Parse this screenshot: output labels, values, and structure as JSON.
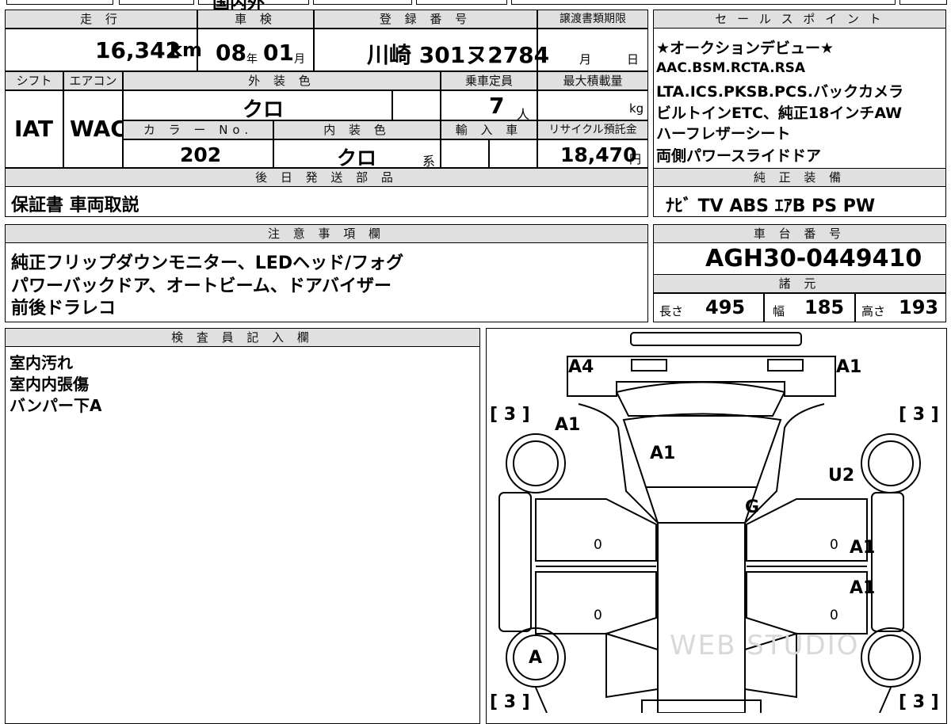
{
  "top_cutoff": "国内外",
  "header_labels": {
    "mileage": "走 行",
    "inspection": "車 検",
    "registration": "登 録 番 号",
    "transfer_deadline": "譲渡書類期限",
    "shift": "シフト",
    "aircon": "エアコン",
    "exterior_color": "外 装 色",
    "capacity": "乗車定員",
    "max_load": "最大積載量",
    "color_no": "カ ラ ー No.",
    "interior_color": "内 装 色",
    "import": "輸 入 車",
    "recycle_fee": "リサイクル預託金",
    "later_parts": "後 日 発 送 部 品",
    "sales_points": "セ ー ル ス ポ イ ン ト",
    "standard_equipment": "純 正 装 備",
    "notes": "注 意 事 項 欄",
    "chassis_no": "車 台 番 号",
    "specs": "諸 元",
    "inspector": "検 査 員 記 入 欄"
  },
  "vehicle": {
    "mileage_value": "16,342",
    "mileage_unit": "km",
    "inspection_year": "08",
    "year_unit": "年",
    "inspection_month": "01",
    "month_unit": "月",
    "plate": "川崎 301ヌ2784",
    "deadline_month_unit": "月",
    "deadline_day_unit": "日",
    "shift": "IAT",
    "aircon": "WAC",
    "exterior_color": "クロ",
    "capacity": "7",
    "capacity_unit": "人",
    "max_load_unit": "kg",
    "color_no": "202",
    "interior_color": "クロ",
    "interior_suffix": "系",
    "recycle_fee": "18,470",
    "recycle_unit": "円"
  },
  "later_parts": "保証書 車両取説",
  "sales_points": [
    "★オークションデビュー★",
    "AAC.BSM.RCTA.RSA",
    "LTA.ICS.PKSB.PCS.バックカメラ",
    "ビルトインETC、純正18インチAW",
    "ハーフレザーシート",
    "両側パワースライドドア"
  ],
  "standard_equipment": "ﾅﾋﾞ TV ABS ｴｱB PS PW",
  "notes": [
    "純正フリップダウンモニター、LEDヘッド/フォグ",
    "パワーバックドア、オートビーム、ドアバイザー",
    "前後ドラレコ"
  ],
  "chassis_no": "AGH30-0449410",
  "specs": {
    "length_label": "長さ",
    "length": "495",
    "width_label": "幅",
    "width": "185",
    "height_label": "高さ",
    "height": "193"
  },
  "inspector_notes": [
    "室内汚れ",
    "室内内張傷",
    "バンパー下A"
  ],
  "diagram": {
    "marks": {
      "front_left_corner": "A4",
      "front_right_corner": "A1",
      "left_fender": "A1",
      "windshield": "A1",
      "right_fender": "U2",
      "roof": "G",
      "right_front_door": "A1",
      "right_rear_door": "A1",
      "left_rear_wheel": "A",
      "tire_fl": "[ 3 ]",
      "tire_fr": "[ 3 ]",
      "tire_rl": "[ 3 ]",
      "tire_rr": "[ 3 ]",
      "lf_door_zero": "0",
      "lr_door_zero": "0",
      "rf_door_zero": "0",
      "rr_door_zero": "0"
    },
    "watermark": "WEB STUDIO"
  }
}
